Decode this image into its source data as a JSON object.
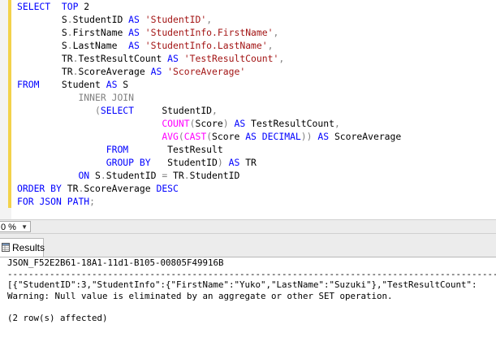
{
  "editor": {
    "lines": [
      [
        {
          "t": "SELECT",
          "c": "kw"
        },
        {
          "t": "  ",
          "c": "id"
        },
        {
          "t": "TOP",
          "c": "kw"
        },
        {
          "t": " 2",
          "c": "id"
        }
      ],
      [
        {
          "t": "        S",
          "c": "id"
        },
        {
          "t": ".",
          "c": "gr"
        },
        {
          "t": "StudentID ",
          "c": "id"
        },
        {
          "t": "AS",
          "c": "kw"
        },
        {
          "t": " ",
          "c": "id"
        },
        {
          "t": "'StudentID'",
          "c": "str"
        },
        {
          "t": ",",
          "c": "gr"
        }
      ],
      [
        {
          "t": "        S",
          "c": "id"
        },
        {
          "t": ".",
          "c": "gr"
        },
        {
          "t": "FirstName ",
          "c": "id"
        },
        {
          "t": "AS",
          "c": "kw"
        },
        {
          "t": " ",
          "c": "id"
        },
        {
          "t": "'StudentInfo.FirstName'",
          "c": "str"
        },
        {
          "t": ",",
          "c": "gr"
        }
      ],
      [
        {
          "t": "        S",
          "c": "id"
        },
        {
          "t": ".",
          "c": "gr"
        },
        {
          "t": "LastName  ",
          "c": "id"
        },
        {
          "t": "AS",
          "c": "kw"
        },
        {
          "t": " ",
          "c": "id"
        },
        {
          "t": "'StudentInfo.LastName'",
          "c": "str"
        },
        {
          "t": ",",
          "c": "gr"
        }
      ],
      [
        {
          "t": "        TR",
          "c": "id"
        },
        {
          "t": ".",
          "c": "gr"
        },
        {
          "t": "TestResultCount ",
          "c": "id"
        },
        {
          "t": "AS",
          "c": "kw"
        },
        {
          "t": " ",
          "c": "id"
        },
        {
          "t": "'TestResultCount'",
          "c": "str"
        },
        {
          "t": ",",
          "c": "gr"
        }
      ],
      [
        {
          "t": "        TR",
          "c": "id"
        },
        {
          "t": ".",
          "c": "gr"
        },
        {
          "t": "ScoreAverage ",
          "c": "id"
        },
        {
          "t": "AS",
          "c": "kw"
        },
        {
          "t": " ",
          "c": "id"
        },
        {
          "t": "'ScoreAverage'",
          "c": "str"
        }
      ],
      [
        {
          "t": "FROM",
          "c": "kw"
        },
        {
          "t": "    Student ",
          "c": "id"
        },
        {
          "t": "AS",
          "c": "kw"
        },
        {
          "t": " S",
          "c": "id"
        }
      ],
      [
        {
          "t": "           ",
          "c": "id"
        },
        {
          "t": "INNER JOIN",
          "c": "gr"
        }
      ],
      [
        {
          "t": "              ",
          "c": "id"
        },
        {
          "t": "(",
          "c": "gr"
        },
        {
          "t": "SELECT",
          "c": "kw"
        },
        {
          "t": "     StudentID",
          "c": "id"
        },
        {
          "t": ",",
          "c": "gr"
        }
      ],
      [
        {
          "t": "                          ",
          "c": "id"
        },
        {
          "t": "COUNT",
          "c": "fn"
        },
        {
          "t": "(",
          "c": "gr"
        },
        {
          "t": "Score",
          "c": "id"
        },
        {
          "t": ")",
          "c": "gr"
        },
        {
          "t": " ",
          "c": "id"
        },
        {
          "t": "AS",
          "c": "kw"
        },
        {
          "t": " TestResultCount",
          "c": "id"
        },
        {
          "t": ",",
          "c": "gr"
        }
      ],
      [
        {
          "t": "                          ",
          "c": "id"
        },
        {
          "t": "AVG",
          "c": "fn"
        },
        {
          "t": "(",
          "c": "gr"
        },
        {
          "t": "CAST",
          "c": "fn"
        },
        {
          "t": "(",
          "c": "gr"
        },
        {
          "t": "Score ",
          "c": "id"
        },
        {
          "t": "AS",
          "c": "kw"
        },
        {
          "t": " ",
          "c": "id"
        },
        {
          "t": "DECIMAL",
          "c": "kw"
        },
        {
          "t": "))",
          "c": "gr"
        },
        {
          "t": " ",
          "c": "id"
        },
        {
          "t": "AS",
          "c": "kw"
        },
        {
          "t": " ScoreAverage",
          "c": "id"
        }
      ],
      [
        {
          "t": "                ",
          "c": "id"
        },
        {
          "t": "FROM",
          "c": "kw"
        },
        {
          "t": "       TestResult",
          "c": "id"
        }
      ],
      [
        {
          "t": "                ",
          "c": "id"
        },
        {
          "t": "GROUP BY",
          "c": "kw"
        },
        {
          "t": "   StudentID",
          "c": "id"
        },
        {
          "t": ")",
          "c": "gr"
        },
        {
          "t": " ",
          "c": "id"
        },
        {
          "t": "AS",
          "c": "kw"
        },
        {
          "t": " TR",
          "c": "id"
        }
      ],
      [
        {
          "t": "           ",
          "c": "id"
        },
        {
          "t": "ON",
          "c": "kw"
        },
        {
          "t": " S",
          "c": "id"
        },
        {
          "t": ".",
          "c": "gr"
        },
        {
          "t": "StudentID ",
          "c": "id"
        },
        {
          "t": "=",
          "c": "gr"
        },
        {
          "t": " TR",
          "c": "id"
        },
        {
          "t": ".",
          "c": "gr"
        },
        {
          "t": "StudentID",
          "c": "id"
        }
      ],
      [
        {
          "t": "ORDER BY",
          "c": "kw"
        },
        {
          "t": " TR",
          "c": "id"
        },
        {
          "t": ".",
          "c": "gr"
        },
        {
          "t": "ScoreAverage ",
          "c": "id"
        },
        {
          "t": "DESC",
          "c": "kw"
        }
      ],
      [
        {
          "t": "FOR",
          "c": "kw"
        },
        {
          "t": " ",
          "c": "id"
        },
        {
          "t": "JSON",
          "c": "kw"
        },
        {
          "t": " ",
          "c": "id"
        },
        {
          "t": "PATH",
          "c": "kw"
        },
        {
          "t": ";",
          "c": "gr"
        }
      ]
    ]
  },
  "zoom": {
    "value": "0 %"
  },
  "results_tab": {
    "label": "Results",
    "icon": "grid-icon"
  },
  "results": {
    "column_header": "JSON_F52E2B61-18A1-11d1-B105-00805F49916B",
    "separator": "-------------------------------------------------------------------------------------------------------------------------",
    "json_row": "[{\"StudentID\":3,\"StudentInfo\":{\"FirstName\":\"Yuko\",\"LastName\":\"Suzuki\"},\"TestResultCount\":",
    "warning": "Warning: Null value is eliminated by an aggregate or other SET operation.",
    "blank": "",
    "affected": "(2 row(s) affected)"
  },
  "colors": {
    "keyword": "#0000ff",
    "string": "#a31515",
    "function": "#ff00ff",
    "operator": "#808080",
    "change_bar": "#f3d24a"
  }
}
